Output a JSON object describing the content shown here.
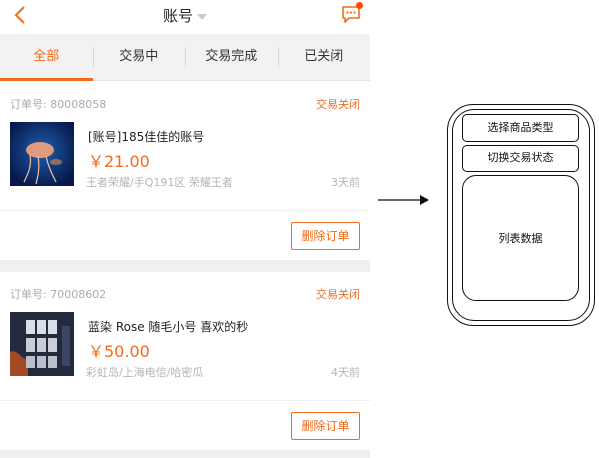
{
  "header": {
    "title": "账号",
    "back_icon": "chevron-left-icon",
    "message_icon": "chat-bubble-icon",
    "accent_color": "#f26a1b"
  },
  "tabs": [
    {
      "label": "全部",
      "active": true
    },
    {
      "label": "交易中",
      "active": false
    },
    {
      "label": "交易完成",
      "active": false
    },
    {
      "label": "已关闭",
      "active": false
    }
  ],
  "orders": [
    {
      "order_no": "订单号: 80008058",
      "status": "交易关闭",
      "title": "[账号]185佳佳的账号",
      "price": "￥21.00",
      "meta": "王者荣耀/手Q191区 荣耀王者",
      "time": "3天前",
      "action": "删除订单"
    },
    {
      "order_no": "订单号: 70008602",
      "status": "交易关闭",
      "title": "蓝染 Rose 随毛小号 喜欢的秒",
      "price": "￥50.00",
      "meta": "彩虹岛/上海电信/哈密瓜",
      "time": "4天前",
      "action": "删除订单"
    }
  ],
  "wireframe": {
    "box1": "选择商品类型",
    "box2": "切换交易状态",
    "box3": "列表数据"
  }
}
